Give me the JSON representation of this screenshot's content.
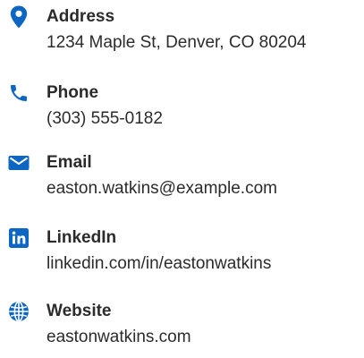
{
  "accent_color": "#0d66c2",
  "contacts": [
    {
      "icon": "map-pin-icon",
      "label": "Address",
      "value": "1234 Maple St, Denver, CO 80204"
    },
    {
      "icon": "phone-icon",
      "label": "Phone",
      "value": "(303) 555-0182"
    },
    {
      "icon": "envelope-icon",
      "label": "Email",
      "value": "easton.watkins@example.com"
    },
    {
      "icon": "linkedin-icon",
      "label": "LinkedIn",
      "value": "linkedin.com/in/eastonwatkins"
    },
    {
      "icon": "globe-icon",
      "label": "Website",
      "value": "eastonwatkins.com"
    }
  ]
}
